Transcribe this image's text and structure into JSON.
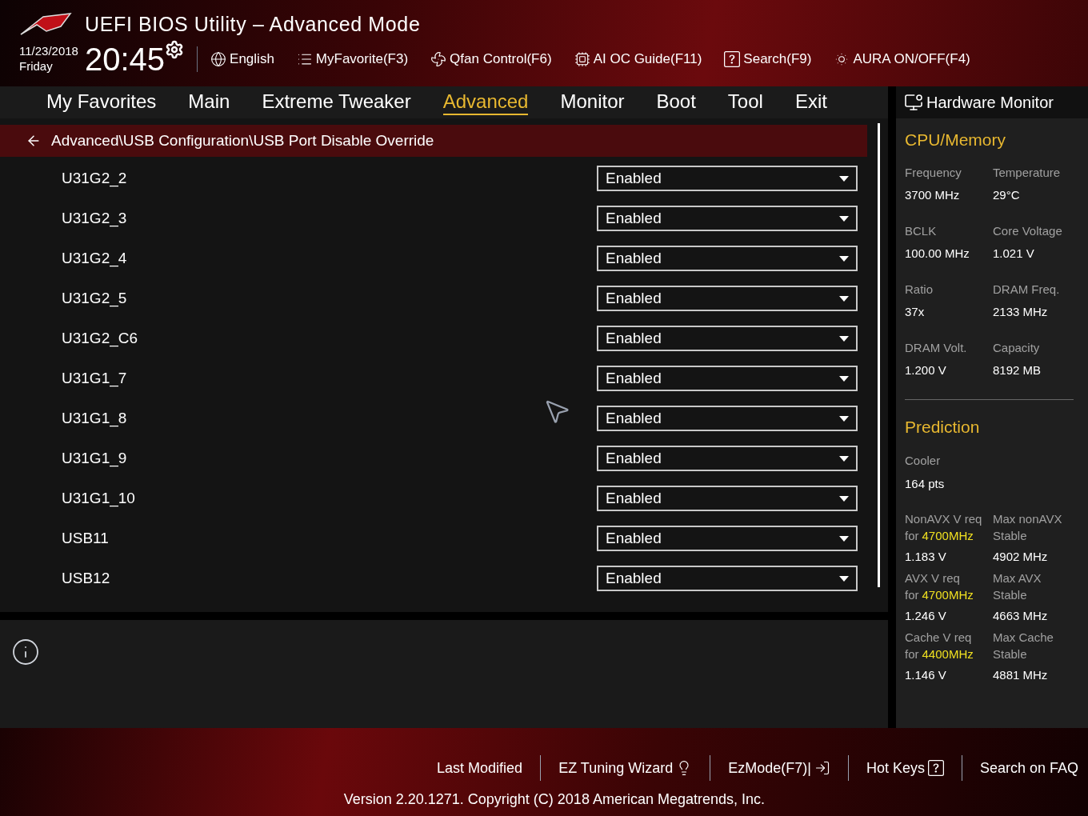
{
  "header": {
    "title": "UEFI BIOS Utility – Advanced Mode",
    "date": "11/23/2018",
    "day": "Friday",
    "time": "20:45",
    "toolbar": [
      {
        "kind": "language",
        "label": "English"
      },
      {
        "kind": "favorite",
        "label": "MyFavorite(F3)"
      },
      {
        "kind": "fan",
        "label": "Qfan Control(F6)"
      },
      {
        "kind": "aioc",
        "label": "AI OC Guide(F11)"
      },
      {
        "kind": "search",
        "label": "Search(F9)"
      },
      {
        "kind": "aura",
        "label": "AURA ON/OFF(F4)"
      }
    ]
  },
  "tabs": [
    {
      "label": "My Favorites",
      "selected": false
    },
    {
      "label": "Main",
      "selected": false
    },
    {
      "label": "Extreme Tweaker",
      "selected": false
    },
    {
      "label": "Advanced",
      "selected": true
    },
    {
      "label": "Monitor",
      "selected": false
    },
    {
      "label": "Boot",
      "selected": false
    },
    {
      "label": "Tool",
      "selected": false
    },
    {
      "label": "Exit",
      "selected": false
    }
  ],
  "breadcrumb": "Advanced\\USB Configuration\\USB Port Disable Override",
  "settings": [
    {
      "label": "U31G2_2",
      "value": "Enabled"
    },
    {
      "label": "U31G2_3",
      "value": "Enabled"
    },
    {
      "label": "U31G2_4",
      "value": "Enabled"
    },
    {
      "label": "U31G2_5",
      "value": "Enabled"
    },
    {
      "label": "U31G2_C6",
      "value": "Enabled"
    },
    {
      "label": "U31G1_7",
      "value": "Enabled"
    },
    {
      "label": "U31G1_8",
      "value": "Enabled"
    },
    {
      "label": "U31G1_9",
      "value": "Enabled"
    },
    {
      "label": "U31G1_10",
      "value": "Enabled"
    },
    {
      "label": "USB11",
      "value": "Enabled"
    },
    {
      "label": "USB12",
      "value": "Enabled"
    }
  ],
  "hardware_monitor": {
    "title": "Hardware Monitor",
    "cpu_title": "CPU/Memory",
    "cpu": [
      {
        "label": "Frequency",
        "value": "3700 MHz"
      },
      {
        "label": "Temperature",
        "value": "29°C"
      },
      {
        "label": "BCLK",
        "value": "100.00 MHz"
      },
      {
        "label": "Core Voltage",
        "value": "1.021 V"
      },
      {
        "label": "Ratio",
        "value": "37x"
      },
      {
        "label": "DRAM Freq.",
        "value": "2133 MHz"
      },
      {
        "label": "DRAM Volt.",
        "value": "1.200 V"
      },
      {
        "label": "Capacity",
        "value": "8192 MB"
      }
    ],
    "prediction_title": "Prediction",
    "cooler_label": "Cooler",
    "cooler_value": "164 pts",
    "prediction": [
      {
        "left_label": "NonAVX V req",
        "for": "for",
        "freq": "4700MHz",
        "left_value": "1.183 V",
        "right_label": "Max nonAVX",
        "right_label2": "Stable",
        "right_value": "4902 MHz"
      },
      {
        "left_label": "AVX V req",
        "for": "for",
        "freq": "4700MHz",
        "left_value": "1.246 V",
        "right_label": "Max AVX",
        "right_label2": "Stable",
        "right_value": "4663 MHz"
      },
      {
        "left_label": "Cache V req",
        "for": "for",
        "freq": "4400MHz",
        "left_value": "1.146 V",
        "right_label": "Max Cache",
        "right_label2": "Stable",
        "right_value": "4881 MHz"
      }
    ]
  },
  "footer": {
    "items": [
      {
        "kind": "plain",
        "label": "Last Modified"
      },
      {
        "kind": "wizard",
        "label": "EZ Tuning Wizard"
      },
      {
        "kind": "ezmode",
        "label": "EzMode(F7)|"
      },
      {
        "kind": "hotkeys",
        "label": "Hot Keys"
      },
      {
        "kind": "plain",
        "label": "Search on FAQ"
      }
    ],
    "version": "Version 2.20.1271. Copyright (C) 2018 American Megatrends, Inc."
  }
}
